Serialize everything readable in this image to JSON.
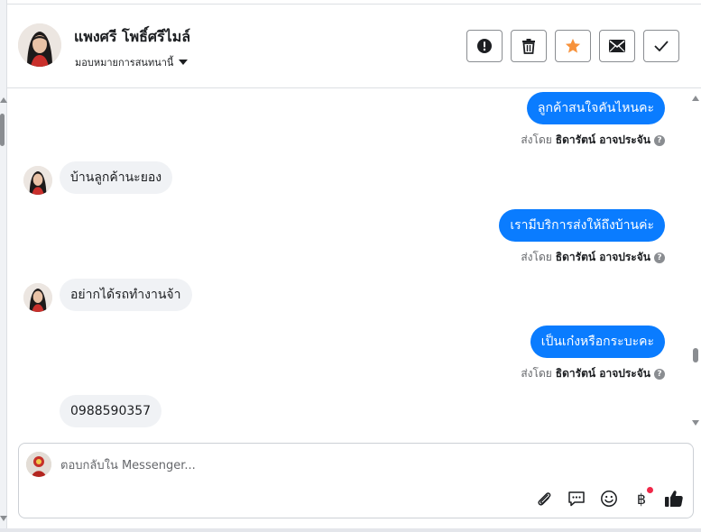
{
  "header": {
    "contact_name": "แพงศรี โพธิ์ศรีไมล์",
    "assign_label": "มอบหมายการสนทนานี้",
    "actions": [
      {
        "name": "report-spam-button",
        "icon": "exclamation-circle-icon"
      },
      {
        "name": "delete-button",
        "icon": "trash-icon"
      },
      {
        "name": "star-button",
        "icon": "star-icon",
        "color": "#f7923b"
      },
      {
        "name": "mark-unread-button",
        "icon": "envelope-icon"
      },
      {
        "name": "mark-done-button",
        "icon": "check-icon"
      }
    ]
  },
  "messages": [
    {
      "direction": "out",
      "text": "ลูกค้าสนใจคันไหนคะ",
      "sent_by_prefix": "ส่งโดย",
      "sent_by": "ธิดารัตน์ อาจประจัน"
    },
    {
      "direction": "in",
      "text": "บ้านลูกค้านะยอง"
    },
    {
      "direction": "out",
      "text": "เรามีบริการส่งให้ถึงบ้านค่ะ",
      "sent_by_prefix": "ส่งโดย",
      "sent_by": "ธิดารัตน์ อาจประจัน"
    },
    {
      "direction": "in",
      "text": "อย่ากได้รถทำงานจ้า"
    },
    {
      "direction": "out",
      "text": "เป็นเก๋งหรือกระบะคะ",
      "sent_by_prefix": "ส่งโดย",
      "sent_by": "ธิดารัตน์ อาจประจัน"
    },
    {
      "direction": "in",
      "text": "0988590357"
    }
  ],
  "composer": {
    "placeholder": "ตอบกลับใน Messenger...",
    "tools": [
      "paperclip-icon",
      "saved-reply-icon",
      "emoji-icon",
      "baht-payment-icon",
      "thumbs-up-icon"
    ],
    "baht_symbol": "฿"
  },
  "colors": {
    "outgoing_bubble": "#0a7cff",
    "incoming_bubble": "#f0f2f5",
    "notification_dot": "#f02849"
  }
}
